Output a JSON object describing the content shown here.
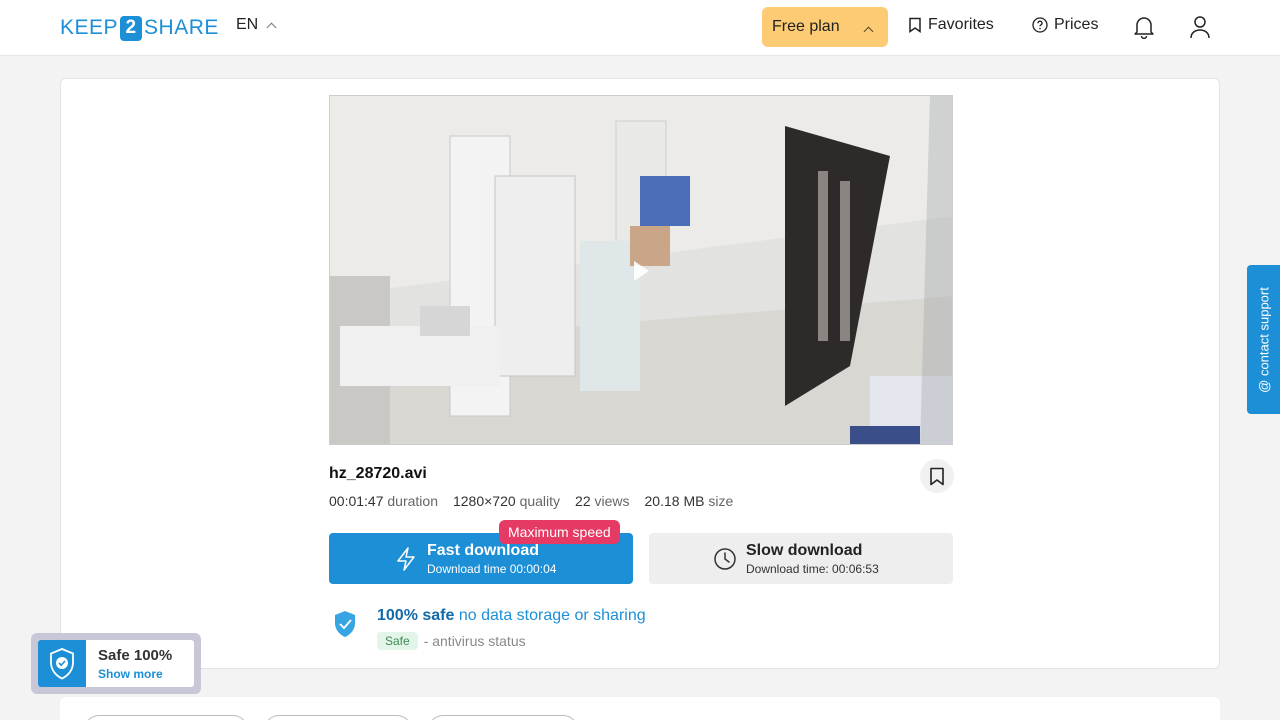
{
  "header": {
    "logo_left": "KEEP",
    "logo_mid": "2",
    "logo_right": "SHARE",
    "lang": "EN",
    "plan_label": "Free plan",
    "favorites_label": "Favorites",
    "prices_label": "Prices"
  },
  "file": {
    "name": "hz_28720.avi",
    "duration": "00:01:47",
    "duration_label": "duration",
    "quality": "1280×720",
    "quality_label": "quality",
    "views": "22",
    "views_label": "views",
    "size": "20.18 MB",
    "size_label": "size"
  },
  "download": {
    "badge": "Maximum speed",
    "fast_title": "Fast download",
    "fast_sub": "Download time 00:00:04",
    "slow_title": "Slow download",
    "slow_sub": "Download time: 00:06:53"
  },
  "safety": {
    "strong": "100% safe",
    "rest": "no data storage or sharing",
    "pill": "Safe",
    "status": "- antivirus status"
  },
  "support": {
    "label": "@ contact support"
  },
  "floater": {
    "title": "Safe 100%",
    "link": "Show more"
  },
  "colors": {
    "brand": "#1d8fd6",
    "plan": "#fccb73",
    "badge": "#e53a64"
  }
}
